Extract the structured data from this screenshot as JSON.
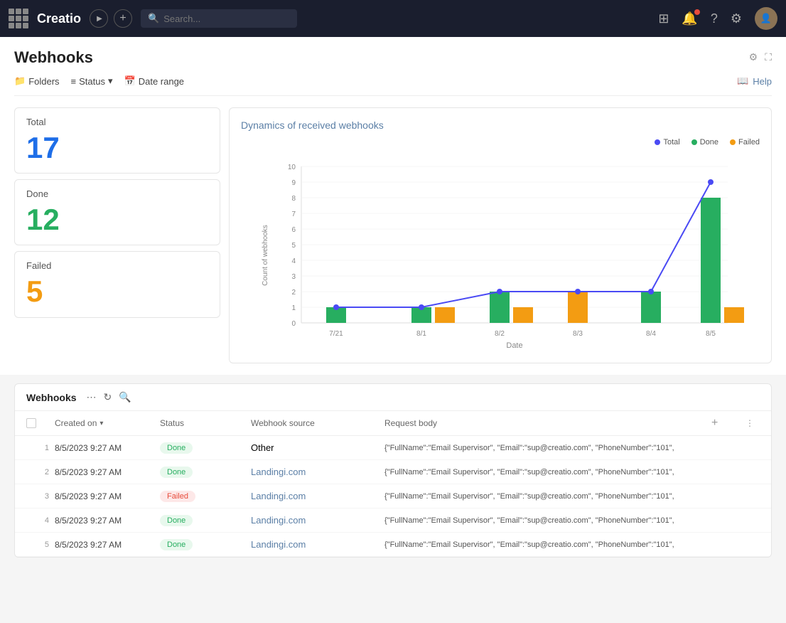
{
  "nav": {
    "logo": "Creatio",
    "search_placeholder": "Search...",
    "help_label": "Help"
  },
  "page": {
    "title": "Webhooks",
    "filters": {
      "folders": "Folders",
      "status": "Status",
      "date_range": "Date range"
    },
    "help": "Help"
  },
  "stats": {
    "total_label": "Total",
    "total_value": "17",
    "done_label": "Done",
    "done_value": "12",
    "failed_label": "Failed",
    "failed_value": "5"
  },
  "chart": {
    "title": "Dynamics of received webhooks",
    "legend": {
      "total": "Total",
      "done": "Done",
      "failed": "Failed"
    },
    "y_label": "Count of webhooks",
    "x_label": "Date",
    "colors": {
      "total": "#4a4af4",
      "done": "#27ae60",
      "failed": "#f39c12"
    },
    "dates": [
      "7/21",
      "8/1",
      "8/2",
      "8/3",
      "8/4",
      "8/5"
    ],
    "total_line": [
      1,
      1,
      2,
      2,
      2,
      9
    ],
    "done_bars": [
      1,
      1,
      2,
      0,
      2,
      8
    ],
    "failed_bars": [
      0,
      1,
      1,
      2,
      0,
      1
    ],
    "y_max": 10
  },
  "webhooks_table": {
    "title": "Webhooks",
    "columns": {
      "created_on": "Created on",
      "status": "Status",
      "source": "Webhook source",
      "body": "Request body"
    },
    "rows": [
      {
        "num": "1",
        "created_on": "8/5/2023 9:27 AM",
        "status": "Done",
        "status_type": "done",
        "source": "Other",
        "source_link": false,
        "body": "{\"FullName\":\"Email Supervisor\", \"Email\":\"sup@creatio.com\", \"PhoneNumber\":\"101\","
      },
      {
        "num": "2",
        "created_on": "8/5/2023 9:27 AM",
        "status": "Done",
        "status_type": "done",
        "source": "Landingi.com",
        "source_link": true,
        "body": "{\"FullName\":\"Email Supervisor\", \"Email\":\"sup@creatio.com\", \"PhoneNumber\":\"101\","
      },
      {
        "num": "3",
        "created_on": "8/5/2023 9:27 AM",
        "status": "Failed",
        "status_type": "failed",
        "source": "Landingi.com",
        "source_link": true,
        "body": "{\"FullName\":\"Email Supervisor\", \"Email\":\"sup@creatio.com\", \"PhoneNumber\":\"101\","
      },
      {
        "num": "4",
        "created_on": "8/5/2023 9:27 AM",
        "status": "Done",
        "status_type": "done",
        "source": "Landingi.com",
        "source_link": true,
        "body": "{\"FullName\":\"Email Supervisor\", \"Email\":\"sup@creatio.com\", \"PhoneNumber\":\"101\","
      },
      {
        "num": "5",
        "created_on": "8/5/2023 9:27 AM",
        "status": "Done",
        "status_type": "done",
        "source": "Landingi.com",
        "source_link": true,
        "body": "{\"FullName\":\"Email Supervisor\", \"Email\":\"sup@creatio.com\", \"PhoneNumber\":\"101\","
      }
    ]
  }
}
